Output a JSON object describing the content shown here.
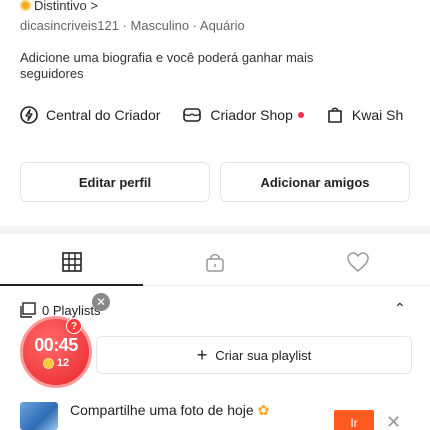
{
  "profile": {
    "badge_label": "Distintivo >",
    "meta": "dicasincriveis121 · Masculino · Aquário",
    "bio": "Adicione uma biografia e você poderá ganhar mais seguidores"
  },
  "creator_links": [
    {
      "label": "Central do Criador",
      "icon": "lightning-circle-icon"
    },
    {
      "label": "Criador Shop",
      "icon": "shop-icon",
      "has_dot": true
    },
    {
      "label": "Kwai Sh",
      "icon": "bag-icon"
    }
  ],
  "actions": {
    "edit_profile": "Editar perfil",
    "add_friends": "Adicionar amigos"
  },
  "tabs": [
    {
      "icon": "grid-icon",
      "active": true
    },
    {
      "icon": "lock-icon",
      "active": false
    },
    {
      "icon": "heart-icon",
      "active": false
    }
  ],
  "playlists": {
    "label": "0 Playlists",
    "create_label": "Criar sua playlist",
    "create_prefix": "+"
  },
  "timer_widget": {
    "time": "00:45",
    "coins": "12",
    "question": "?"
  },
  "share_banner": {
    "text": "Compartilhe uma foto de hoje",
    "button": "Ir"
  },
  "colors": {
    "accent": "#ff5a1f",
    "timer_red": "#e8262d",
    "dot_red": "#ff2d55"
  }
}
